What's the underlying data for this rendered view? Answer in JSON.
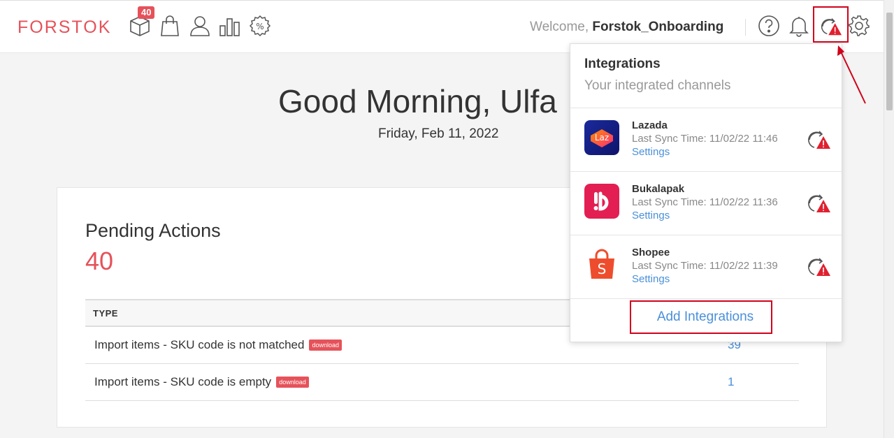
{
  "app": {
    "logo_text": "FORSTOK",
    "brand_color": "#e6525a"
  },
  "nav": {
    "badge_count": "40",
    "icons": [
      "box-icon",
      "shopping-bag-icon",
      "user-icon",
      "bar-chart-icon",
      "promo-badge-icon"
    ],
    "welcome_prefix": "Welcome,",
    "username": "Forstok_Onboarding",
    "right_icons": [
      "help-icon",
      "bell-icon",
      "sync-warning-icon",
      "gear-icon"
    ]
  },
  "main": {
    "greeting": "Good Morning, Ulfa",
    "date": "Friday, Feb 11, 2022"
  },
  "pending": {
    "title": "Pending Actions",
    "count": "40",
    "column_type": "TYPE",
    "rows": [
      {
        "label": "Import items - SKU code is not matched",
        "tag": "download",
        "count": "39"
      },
      {
        "label": "Import items - SKU code is empty",
        "tag": "download",
        "count": "1"
      }
    ]
  },
  "integrations": {
    "title": "Integrations",
    "subtitle": "Your integrated channels",
    "items": [
      {
        "name": "Lazada",
        "sync": "Last Sync Time: 11/02/22 11:46",
        "settings": "Settings",
        "logo_text": "Laz",
        "status": "sync-warning"
      },
      {
        "name": "Bukalapak",
        "sync": "Last Sync Time: 11/02/22 11:36",
        "settings": "Settings",
        "status": "sync-warning"
      },
      {
        "name": "Shopee",
        "sync": "Last Sync Time: 11/02/22 11:39",
        "settings": "Settings",
        "logo_text": "S",
        "status": "sync-warning"
      }
    ],
    "add_label": "Add Integrations"
  },
  "colors": {
    "accent": "#e6525a",
    "link": "#4a90d9",
    "annotation": "#d0021b"
  }
}
